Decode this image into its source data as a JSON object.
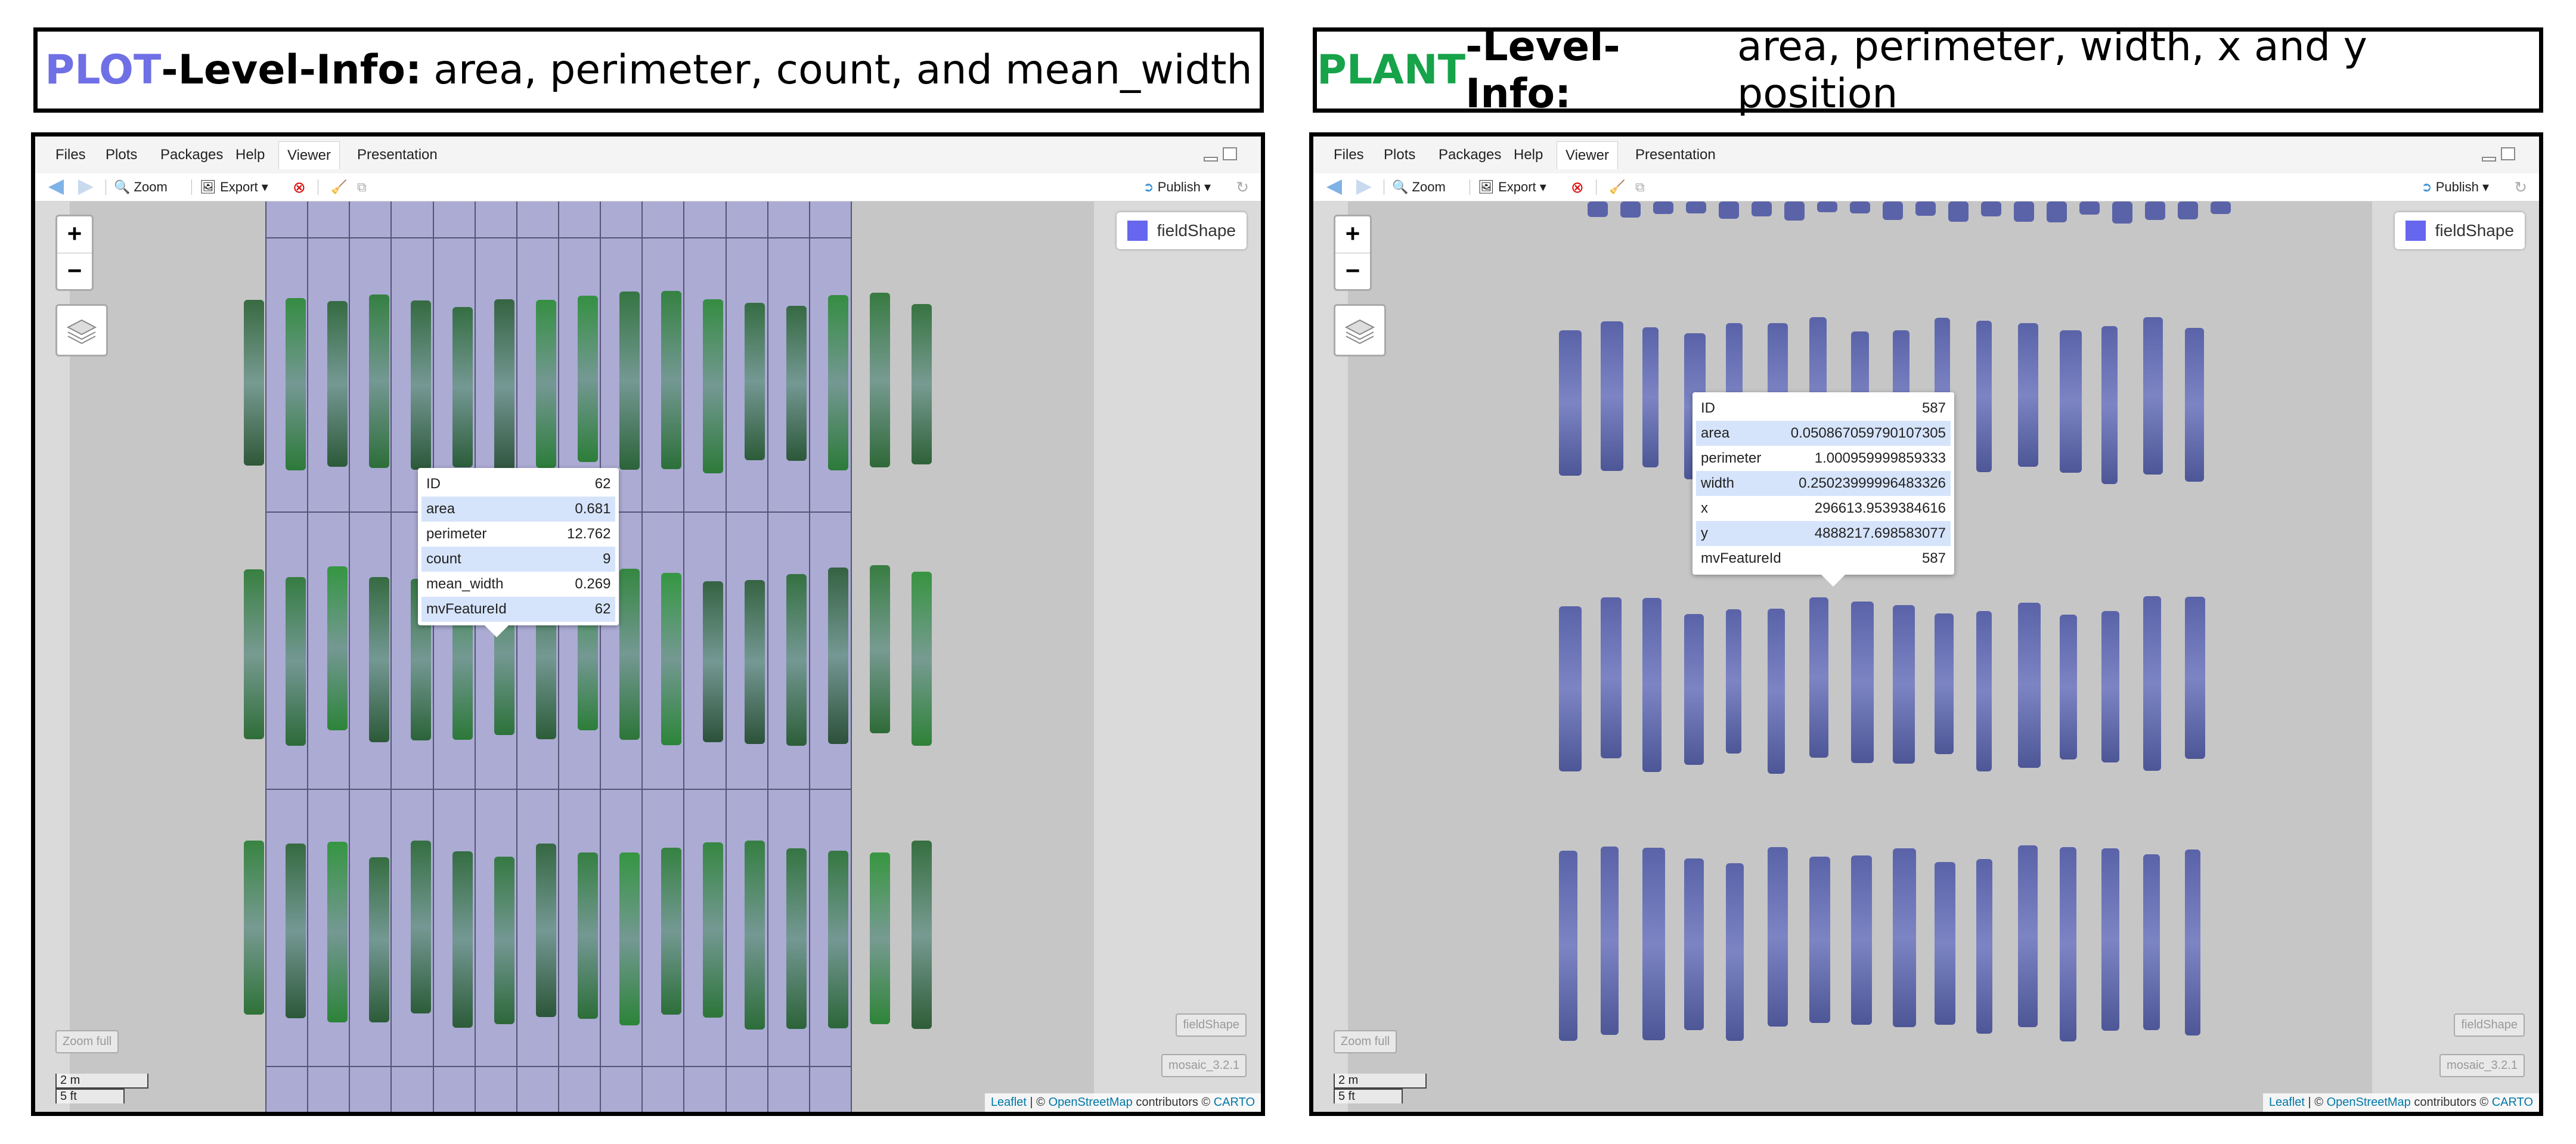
{
  "colors": {
    "plot_accent": "#6f6fe6",
    "plant_accent": "#16a34a",
    "field_shape": "#6666ee",
    "popup_alt_row": "#d6e4fb",
    "link": "#0078a8"
  },
  "left_header": {
    "key": "PLOT",
    "rest": "-Level-Info:",
    "desc": "area, perimeter, count, and mean_width"
  },
  "right_header": {
    "key": "PLANT",
    "rest": "-Level-Info:",
    "desc": "area, perimeter, width, x and y position"
  },
  "tabs": [
    "Files",
    "Plots",
    "Packages",
    "Help",
    "Viewer",
    "Presentation"
  ],
  "active_tab": "Viewer",
  "toolbar": {
    "zoom_label": "Zoom",
    "export_label": "Export",
    "publish_label": "Publish",
    "back_icon": "back-arrow-icon",
    "forward_icon": "forward-arrow-icon",
    "zoom_icon": "magnifier-icon",
    "clear_icon": "broom-icon",
    "refresh_icon": "refresh-icon"
  },
  "map": {
    "zoom_in": "+",
    "zoom_out": "−",
    "legend_label": "fieldShape",
    "zoom_full_label": "Zoom full",
    "layer_tags": [
      "fieldShape",
      "mosaic_3.2.1"
    ],
    "scale_metric": "2 m",
    "scale_imperial": "5 ft",
    "attribution": {
      "leaflet": "Leaflet",
      "sep1": " | © ",
      "osm": "OpenStreetMap",
      "contrib": " contributors © ",
      "carto": "CARTO"
    }
  },
  "left_popup": {
    "rows": [
      {
        "key": "ID",
        "value": "62"
      },
      {
        "key": "area",
        "value": "0.681"
      },
      {
        "key": "perimeter",
        "value": "12.762"
      },
      {
        "key": "count",
        "value": "9"
      },
      {
        "key": "mean_width",
        "value": "0.269"
      },
      {
        "key": "mvFeatureId",
        "value": "62"
      }
    ]
  },
  "right_popup": {
    "rows": [
      {
        "key": "ID",
        "value": "587"
      },
      {
        "key": "area",
        "value": "0.050867059790107305"
      },
      {
        "key": "perimeter",
        "value": "1.000959999859333"
      },
      {
        "key": "width",
        "value": "0.25023999996483326"
      },
      {
        "key": "x",
        "value": "296613.9539384616"
      },
      {
        "key": "y",
        "value": "4888217.698583077"
      },
      {
        "key": "mvFeatureId",
        "value": "587"
      }
    ]
  }
}
